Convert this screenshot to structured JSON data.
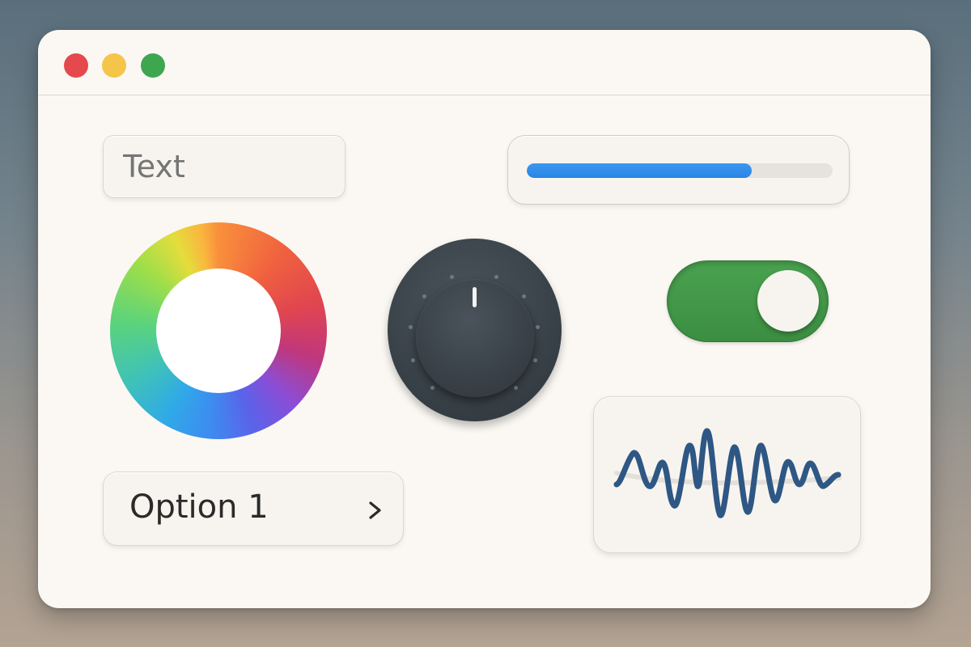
{
  "window": {
    "controls": {
      "close_color": "#e5484d",
      "minimize_color": "#f5c54a",
      "maximize_color": "#3fa650"
    }
  },
  "text_field": {
    "placeholder": "Text"
  },
  "progress": {
    "value_fraction": 0.735,
    "fill_color": "#2f8ce9"
  },
  "color_wheel": {
    "icon": "color-wheel"
  },
  "knob": {
    "icon": "rotary-knob"
  },
  "toggle": {
    "state": "on",
    "on_color": "#44994a"
  },
  "waveform": {
    "icon": "waveform-icon",
    "stroke_color": "#2e5784"
  },
  "dropdown": {
    "selected": "Option 1",
    "icon": "chevron-right-icon"
  }
}
